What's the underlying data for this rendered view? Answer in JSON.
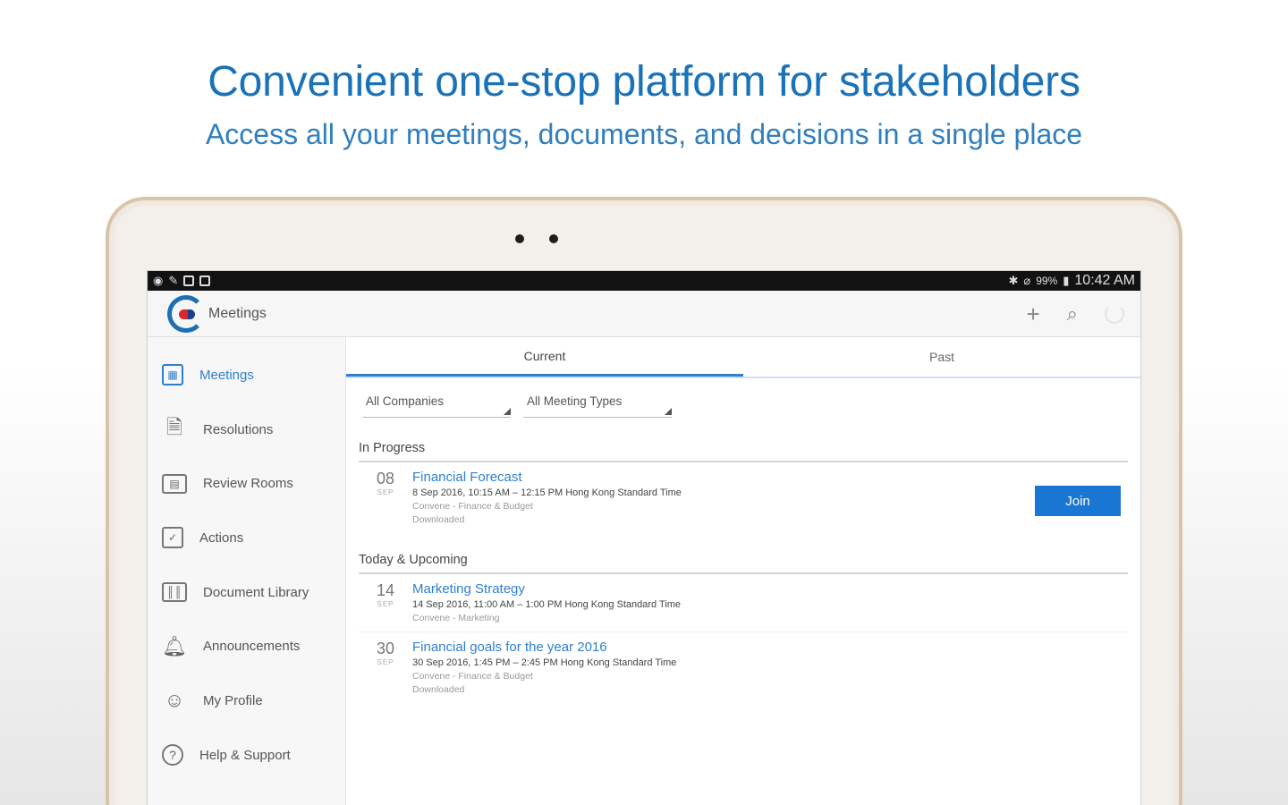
{
  "headline": "Convenient one-stop platform for stakeholders",
  "subheadline": "Access all your meetings, documents, and decisions in a single place",
  "status_bar": {
    "battery": "99%",
    "time": "10:42 AM"
  },
  "app_bar": {
    "title": "Meetings",
    "actions": [
      "add-icon",
      "search-icon",
      "refresh-icon"
    ]
  },
  "sidebar": {
    "items": [
      {
        "label": "Meetings",
        "icon": "calendar-icon",
        "active": true
      },
      {
        "label": "Resolutions",
        "icon": "document-icon"
      },
      {
        "label": "Review Rooms",
        "icon": "review-room-icon"
      },
      {
        "label": "Actions",
        "icon": "clipboard-check-icon"
      },
      {
        "label": "Document Library",
        "icon": "library-icon"
      },
      {
        "label": "Announcements",
        "icon": "bell-icon"
      },
      {
        "label": "My Profile",
        "icon": "person-icon"
      },
      {
        "label": "Help & Support",
        "icon": "help-icon"
      }
    ]
  },
  "tabs": [
    {
      "label": "Current",
      "active": true
    },
    {
      "label": "Past"
    }
  ],
  "filters": {
    "companies": "All Companies",
    "meeting_types": "All Meeting Types"
  },
  "sections": {
    "in_progress": {
      "title": "In Progress",
      "meetings": [
        {
          "day": "08",
          "month": "SEP",
          "title": "Financial Forecast",
          "time": "8 Sep 2016, 10:15 AM – 12:15 PM Hong Kong Standard Time",
          "meta": "Convene - Finance & Budget",
          "status": "Downloaded",
          "join_label": "Join"
        }
      ]
    },
    "upcoming": {
      "title": "Today & Upcoming",
      "meetings": [
        {
          "day": "14",
          "month": "SEP",
          "title": "Marketing Strategy",
          "time": "14 Sep 2016, 11:00 AM – 1:00 PM Hong Kong Standard Time",
          "meta": "Convene - Marketing"
        },
        {
          "day": "30",
          "month": "SEP",
          "title": "Financial goals for the year 2016",
          "time": "30 Sep 2016, 1:45 PM – 2:45 PM Hong Kong Standard Time",
          "meta": "Convene - Finance & Budget",
          "status": "Downloaded"
        }
      ]
    }
  },
  "colors": {
    "accent": "#1976d2",
    "headline": "#1a73b8",
    "link": "#2f7fd1",
    "tablet_frame": "#d9c4a7"
  }
}
